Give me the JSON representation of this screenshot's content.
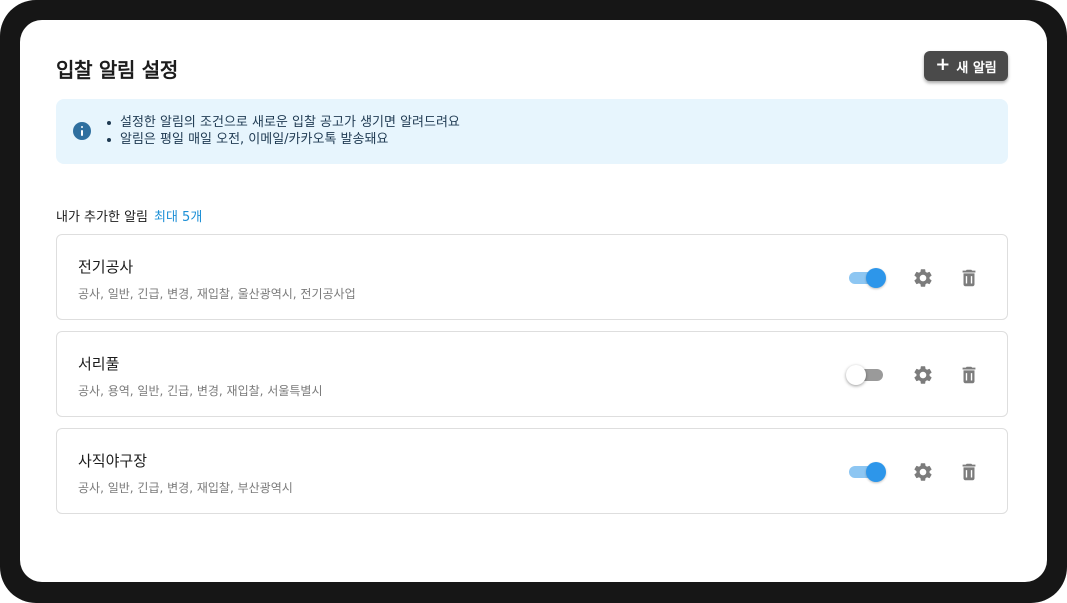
{
  "page": {
    "title": "입찰 알림 설정"
  },
  "new_button": {
    "icon": "plus-icon",
    "label": "새 알림"
  },
  "info": {
    "icon": "info-icon",
    "lines": [
      "설정한 알림의 조건으로 새로운 입찰 공고가 생기면 알려드려요",
      "알림은 평일 매일 오전, 이메일/카카오톡 발송돼요"
    ]
  },
  "section": {
    "label": "내가 추가한 알림",
    "limit": "최대 5개"
  },
  "alerts": [
    {
      "name": "전기공사",
      "tags": "공사, 일반, 긴급, 변경, 재입찰, 울산광역시, 전기공사업",
      "enabled": true
    },
    {
      "name": "서리풀",
      "tags": "공사, 용역, 일반, 긴급, 변경, 재입찰, 서울특별시",
      "enabled": false
    },
    {
      "name": "사직야구장",
      "tags": "공사, 일반, 긴급, 변경, 재입찰, 부산광역시",
      "enabled": true
    }
  ],
  "colors": {
    "toggle_on": "#2d96ea",
    "toggle_on_track": "#8dc6f2",
    "toggle_off_track": "#9a9a9a",
    "info_bg": "#e7f5fd",
    "accent_text": "#1c8fd6",
    "button_bg": "#4a4a4a"
  }
}
